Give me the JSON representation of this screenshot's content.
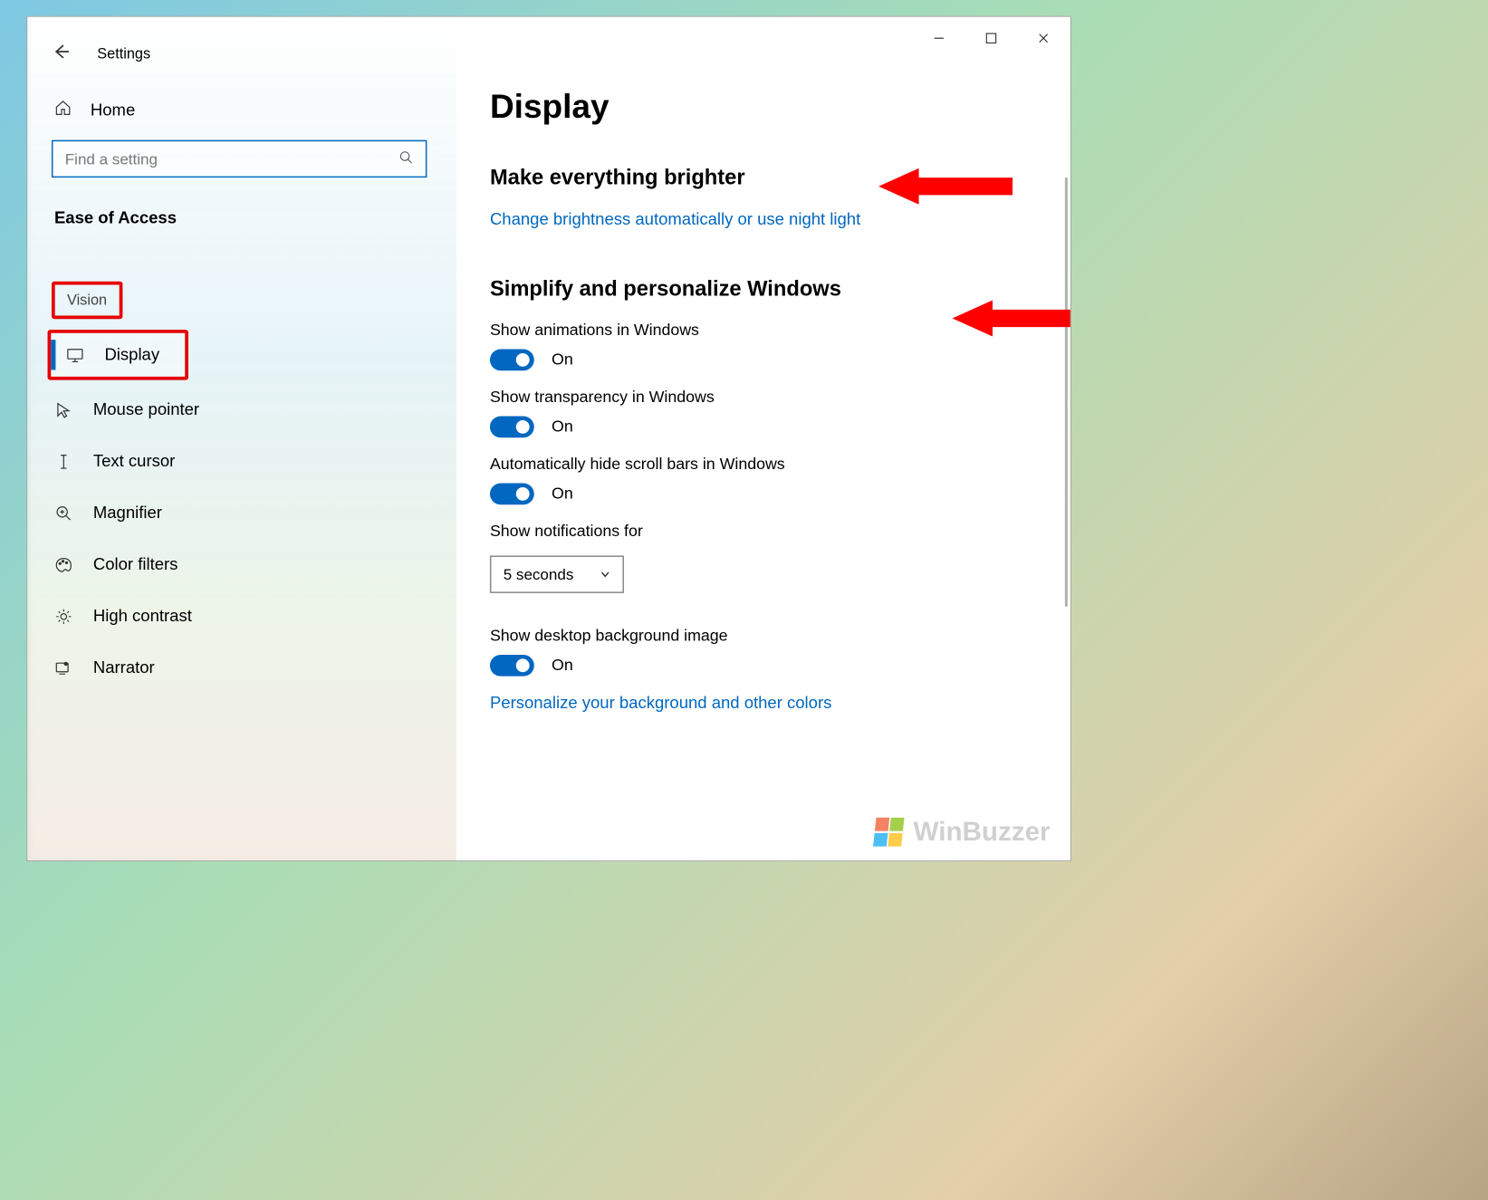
{
  "header": {
    "title": "Settings"
  },
  "sidebar": {
    "home": "Home",
    "search_placeholder": "Find a setting",
    "category": "Ease of Access",
    "group": "Vision",
    "items": [
      {
        "label": "Display"
      },
      {
        "label": "Mouse pointer"
      },
      {
        "label": "Text cursor"
      },
      {
        "label": "Magnifier"
      },
      {
        "label": "Color filters"
      },
      {
        "label": "High contrast"
      },
      {
        "label": "Narrator"
      }
    ]
  },
  "main": {
    "page_title": "Display",
    "section1": "Make everything brighter",
    "link1": "Change brightness automatically or use night light",
    "section2": "Simplify and personalize Windows",
    "settings": [
      {
        "label": "Show animations in Windows",
        "state": "On"
      },
      {
        "label": "Show transparency in Windows",
        "state": "On"
      },
      {
        "label": "Automatically hide scroll bars in Windows",
        "state": "On"
      }
    ],
    "notif_label": "Show notifications for",
    "notif_value": "5 seconds",
    "bg_label": "Show desktop background image",
    "bg_state": "On",
    "link2": "Personalize your background and other colors"
  },
  "watermark": "WinBuzzer"
}
